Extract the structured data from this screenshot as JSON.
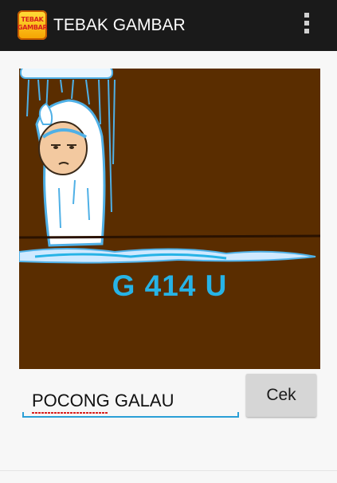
{
  "app": {
    "title": "TEBAK GAMBAR",
    "icon_text": "TEBAK GAMBAR",
    "icon": "app-logo",
    "menu_icon": "overflow-menu-icon"
  },
  "puzzle": {
    "clue": "G 414 U",
    "background_color": "#5a2d00",
    "clue_color": "#27b3e6"
  },
  "answer": {
    "value": "POCONG GALAU"
  },
  "check_button": {
    "label": "Cek"
  },
  "colors": {
    "actionbar": "#1a1a1a",
    "accent": "#2a9fd6"
  }
}
